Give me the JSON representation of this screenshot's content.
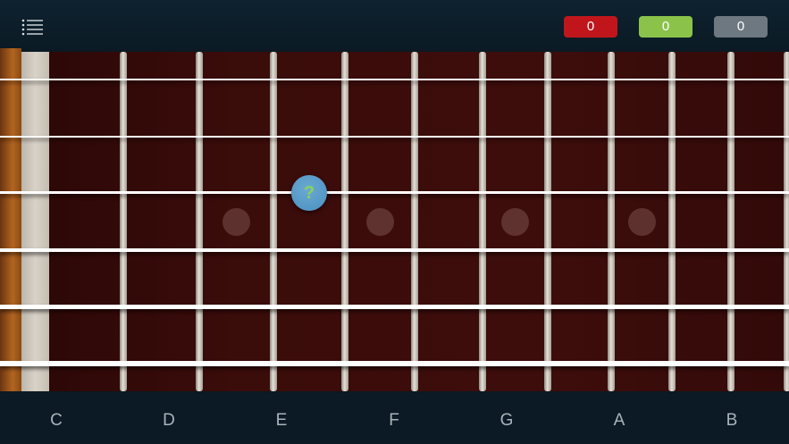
{
  "scores": {
    "wrong": "0",
    "right": "0",
    "skipped": "0"
  },
  "marker": {
    "label": "?"
  },
  "notes": [
    "C",
    "D",
    "E",
    "F",
    "G",
    "A",
    "B"
  ],
  "colors": {
    "wrong": "#c0161b",
    "right": "#8bc34a",
    "skipped": "#6d7880",
    "marker": "#4b8fbf",
    "marker_text": "#8bd15a",
    "fretboard": "#3a0c0a"
  },
  "icons": {
    "menu": "list-menu-icon"
  }
}
